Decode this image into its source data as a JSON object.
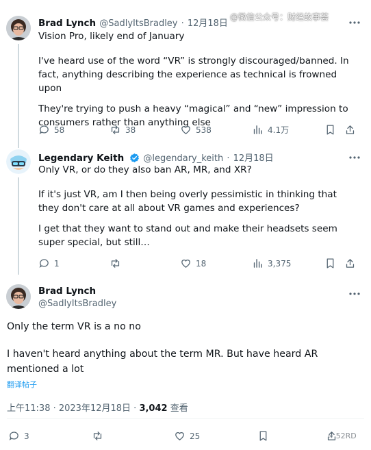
{
  "watermark": "@微信公众号：财经故事荟",
  "tweet1": {
    "name": "Brad Lynch",
    "handle": "@SadlyItsBradley",
    "date": "12月18日",
    "paragraphs": [
      "Vision Pro, likely end of January",
      "I've heard use of the word “VR” is strongly discouraged/banned. In fact, anything describing the experience as technical is frowned upon",
      "They're trying to push a heavy “magical” and “new” impression to consumers rather than anything else"
    ],
    "replies": "58",
    "reposts": "38",
    "likes": "538",
    "views": "4.1万"
  },
  "tweet2": {
    "name": "Legendary Keith",
    "handle": "@legendary_keith",
    "date": "12月18日",
    "paragraphs": [
      "Only VR, or do they also ban AR, MR, and XR?",
      "If it's just VR, am I then being overly pessimistic in thinking that they don't care at all about VR games and experiences?",
      "I get that they want to stand out and make their headsets seem super special, but still…"
    ],
    "replies": "1",
    "reposts": "",
    "likes": "18",
    "views": "3,375"
  },
  "tweet3": {
    "name": "Brad Lynch",
    "handle": "@SadlyItsBradley",
    "paragraphs": [
      "Only the term VR is a no no",
      "I haven't heard anything about the term MR. But have heard AR mentioned a lot"
    ],
    "translate": "翻译帖子",
    "time": "上午11:38 · 2023年12月18日 · ",
    "views_count": "3,042",
    "views_label": " 查看",
    "replies": "3",
    "likes": "25"
  },
  "bottom_watermark": "52RD",
  "colors": {
    "accent": "#1d9bf0",
    "muted": "#536471",
    "text": "#0f1419"
  }
}
